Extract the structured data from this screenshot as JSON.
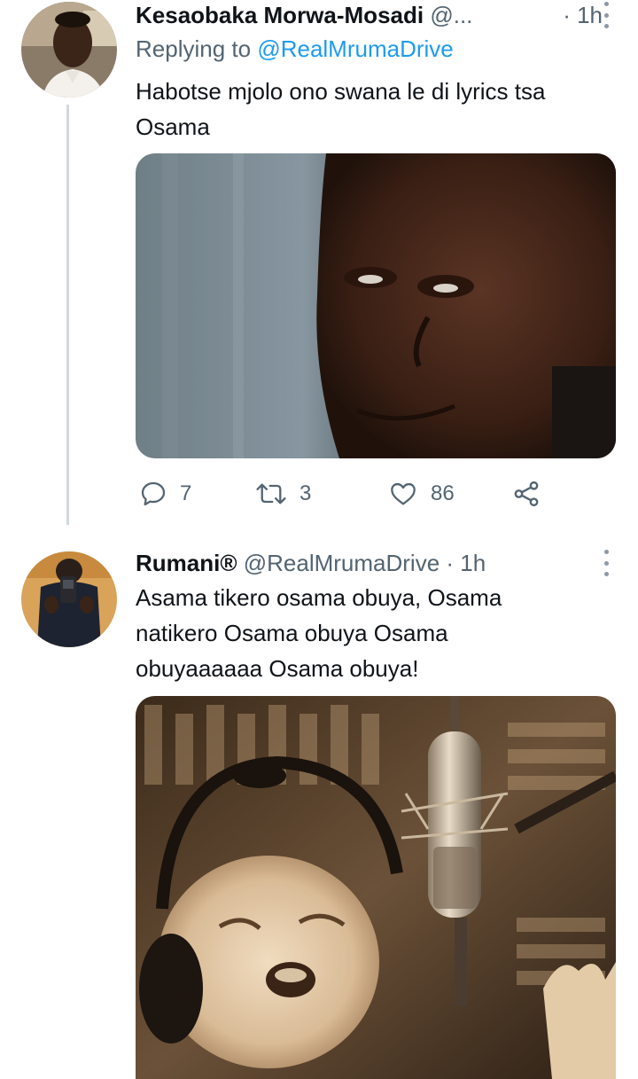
{
  "tweet1": {
    "name": "Kesaobaka Morwa-Mosadi",
    "handle": "@...",
    "time": "· 1h",
    "replying_prefix": "Replying to",
    "replying_handle": "@RealMrumaDrive",
    "text": "Habotse mjolo ono swana le di lyrics tsa Osama",
    "stats": {
      "replies": "7",
      "retweets": "3",
      "likes": "86"
    }
  },
  "tweet2": {
    "name": "Rumani®",
    "handle": "@RealMrumaDrive",
    "time": "· 1h",
    "text": "Asama tikero osama obuya, Osama natikero Osama obuya Osama obuyaaaaaa Osama obuya!"
  },
  "icons": {
    "reply": "comment-bubble",
    "retweet": "retweet-arrows",
    "like": "heart-outline",
    "share": "share-nodes",
    "more": "vertical-dots"
  },
  "colors": {
    "link": "#1d9bf0",
    "secondary": "#536471",
    "thread_line": "#cfd9de"
  }
}
